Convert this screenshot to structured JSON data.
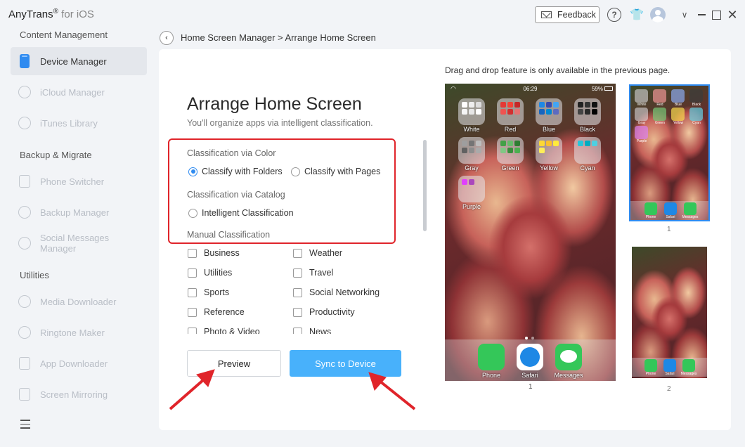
{
  "app": {
    "title": "AnyTrans",
    "reg": "®",
    "subtitle": " for iOS",
    "feedback_label": "Feedback",
    "help_glyph": "?",
    "shirt_glyph": "👕",
    "chevron_glyph": "∨",
    "close_glyph": "✕"
  },
  "sidebar": {
    "sections": [
      {
        "title": "Content Management",
        "items": [
          "Device Manager",
          "iCloud Manager",
          "iTunes Library"
        ]
      },
      {
        "title": "Backup & Migrate",
        "items": [
          "Phone Switcher",
          "Backup Manager",
          "Social Messages Manager"
        ]
      },
      {
        "title": "Utilities",
        "items": [
          "Media Downloader",
          "Ringtone Maker",
          "App Downloader",
          "Screen Mirroring"
        ]
      }
    ],
    "active_item": "Device Manager"
  },
  "breadcrumb": {
    "back_glyph": "‹",
    "text": "Home Screen Manager > Arrange Home Screen"
  },
  "main": {
    "title": "Arrange Home Screen",
    "subtitle": "You'll organize apps via intelligent classification.",
    "color_group": {
      "label": "Classification via Color",
      "options": [
        {
          "label": "Classify with Folders",
          "selected": true
        },
        {
          "label": "Classify with Pages",
          "selected": false
        }
      ]
    },
    "catalog_group": {
      "label": "Classification via Catalog",
      "options": [
        {
          "label": "Intelligent Classification",
          "selected": false
        }
      ]
    },
    "manual_group": {
      "label": "Manual Classification",
      "left": [
        "Business",
        "Utilities",
        "Sports",
        "Reference",
        "Photo & Video"
      ],
      "right": [
        "Weather",
        "Travel",
        "Social Networking",
        "Productivity",
        "News"
      ]
    },
    "preview_label": "Preview",
    "sync_label": "Sync to Device"
  },
  "preview_panel": {
    "note": "Drag and drop feature is only available in the previous page.",
    "status_time": "06:29",
    "status_battery": "59%",
    "folders": [
      "White",
      "Red",
      "Blue",
      "Black",
      "Gray",
      "Green",
      "Yellow",
      "Cyan",
      "Purple"
    ],
    "dock": [
      "Phone",
      "Safari",
      "Messages"
    ],
    "main_page_number": "1",
    "thumb1_number": "1",
    "thumb2_number": "2"
  },
  "colors": {
    "accent": "#2f8bf0",
    "sync_button": "#48b1fb",
    "highlight_red": "#e0242a",
    "phone_green": "#34c759",
    "safari_blue": "#1e88e5"
  }
}
